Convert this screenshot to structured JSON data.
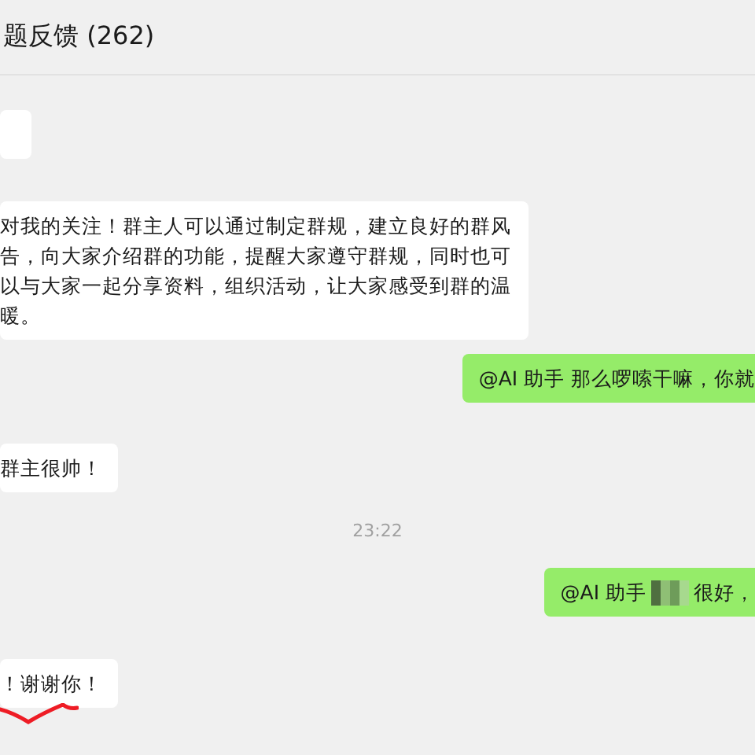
{
  "header": {
    "title": "题反馈 (262)"
  },
  "messages": [
    {
      "kind": "incoming"
    },
    {
      "kind": "incoming",
      "text": "对我的关注！群主人可以通过制定群规，建立良好的群风告，向大家介绍群的功能，提醒大家遵守群规，同时也可以与大家一起分享资料，组织活动，让大家感受到群的温暖。"
    },
    {
      "kind": "outgoing",
      "text": "@AI 助手 那么啰嗦干嘛，你就"
    },
    {
      "kind": "incoming",
      "text": "群主很帅！"
    },
    {
      "kind": "time",
      "text": "23:22"
    },
    {
      "kind": "outgoing",
      "text": "@AI 助手",
      "redacted": true,
      "after": "很好，"
    },
    {
      "kind": "incoming",
      "text": "！谢谢你！",
      "scribbled": true
    }
  ]
}
